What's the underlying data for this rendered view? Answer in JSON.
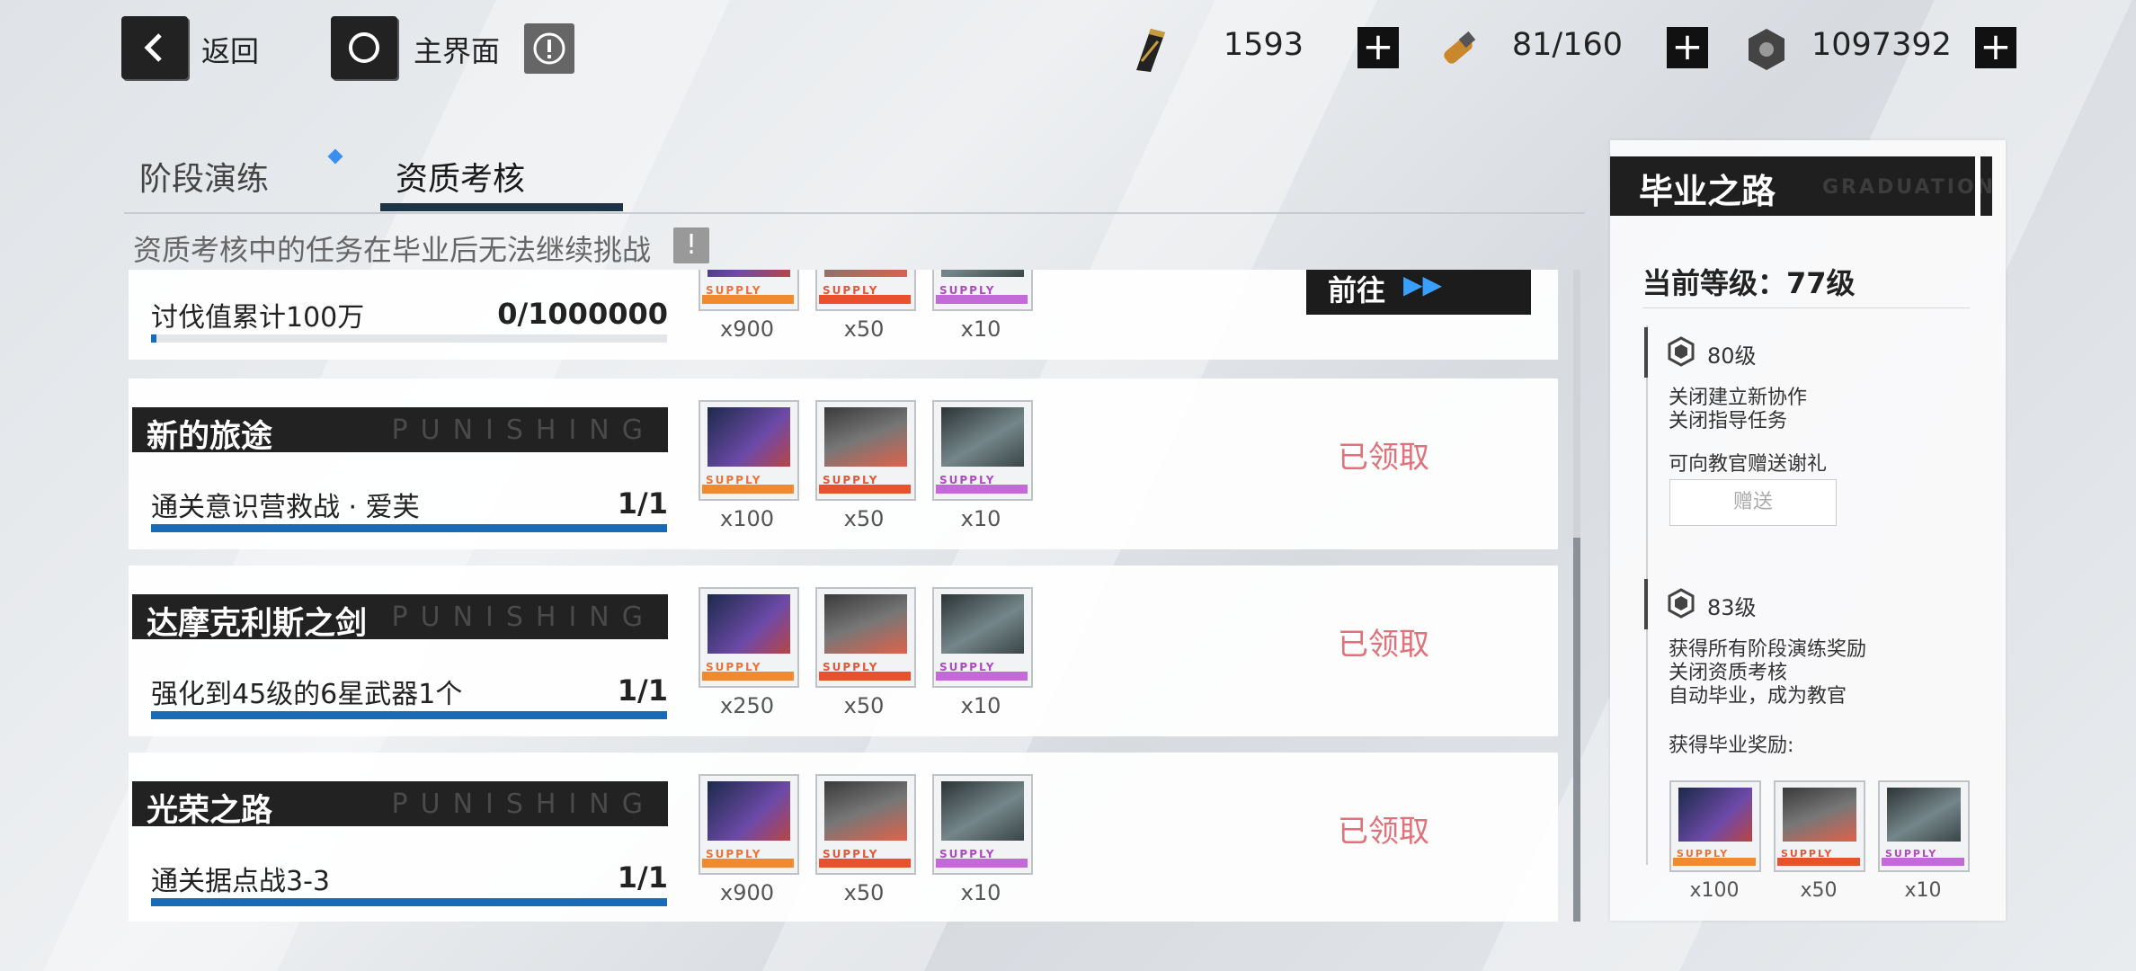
{
  "topbar": {
    "back_label": "返回",
    "home_label": "主界面",
    "resources": [
      {
        "icon": "black-card-icon",
        "value": "1593"
      },
      {
        "icon": "serum-icon",
        "value": "81/160"
      },
      {
        "icon": "coin-icon",
        "value": "1097392"
      }
    ]
  },
  "tabs": [
    {
      "label": "阶段演练"
    },
    {
      "label": "资质考核"
    }
  ],
  "notice": "资质考核中的任务在毕业后无法继续挑战",
  "tasks": [
    {
      "title": "",
      "task": "讨伐值累计100万",
      "progress": "0/1000000",
      "progress_value": 0.0,
      "rewards": [
        "x900",
        "x50",
        "x10"
      ],
      "status": "前往"
    },
    {
      "title": "新的旅途",
      "watermark": "PUNISHING",
      "task": "通关意识营救战 · 爱芙",
      "progress": "1/1",
      "progress_value": 1.0,
      "rewards": [
        "x100",
        "x50",
        "x10"
      ],
      "status": "已领取"
    },
    {
      "title": "达摩克利斯之剑",
      "watermark": "PUNISHING",
      "task": "强化到45级的6星武器1个",
      "progress": "1/1",
      "progress_value": 1.0,
      "rewards": [
        "x250",
        "x50",
        "x10"
      ],
      "status": "已领取"
    },
    {
      "title": "光荣之路",
      "watermark": "PUNISHING",
      "task": "通关据点战3-3",
      "progress": "1/1",
      "progress_value": 1.0,
      "rewards": [
        "x900",
        "x50",
        "x10"
      ],
      "status": "已领取"
    }
  ],
  "reward_supply_text": "SUPPLY",
  "panel": {
    "title": "毕业之路",
    "title_en": "GRADUATION",
    "current_level": "当前等级：77级",
    "level1": {
      "label": "80级",
      "lines": [
        "关闭建立新协作",
        "关闭指导任务"
      ],
      "gift_hint": "可向教官赠送谢礼",
      "gift_button": "赠送"
    },
    "level2": {
      "label": "83级",
      "lines": [
        "获得所有阶段演练奖励",
        "关闭资质考核",
        "自动毕业，成为教官"
      ],
      "reward_title": "获得毕业奖励:"
    },
    "rewards": [
      "x100",
      "x50",
      "x10"
    ]
  },
  "colors": {
    "claimed": "#e0707a",
    "progress": "#1a6bb5",
    "tab_active": "#1d3347"
  }
}
